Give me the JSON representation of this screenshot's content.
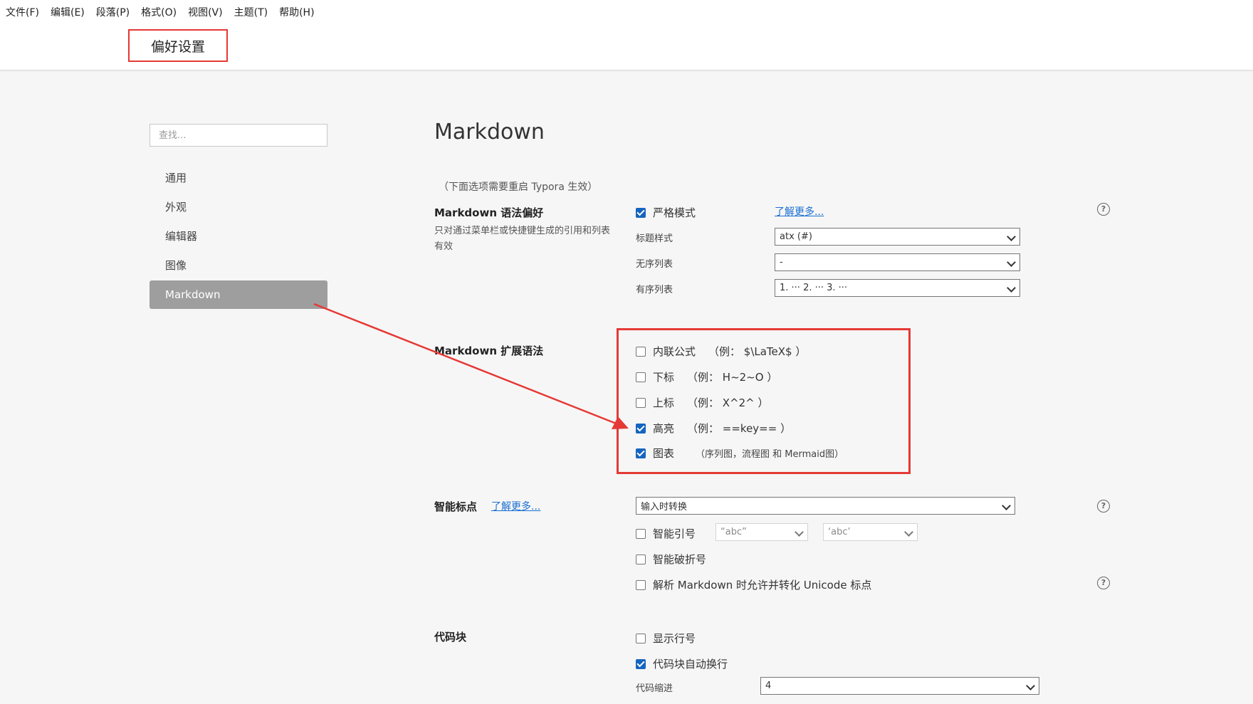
{
  "menubar": [
    "文件(F)",
    "编辑(E)",
    "段落(P)",
    "格式(O)",
    "视图(V)",
    "主题(T)",
    "帮助(H)"
  ],
  "window_title": "偏好设置",
  "sidebar": {
    "search_placeholder": "查找...",
    "items": [
      {
        "label": "通用",
        "active": false
      },
      {
        "label": "外观",
        "active": false
      },
      {
        "label": "编辑器",
        "active": false
      },
      {
        "label": "图像",
        "active": false
      },
      {
        "label": "Markdown",
        "active": true
      }
    ]
  },
  "main": {
    "title": "Markdown",
    "restart_note": "（下面选项需要重启 Typora 生效）",
    "syntax_pref": {
      "title": "Markdown 语法偏好",
      "desc": "只对通过菜单栏或快捷键生成的引用和列表有效",
      "strict_mode": {
        "label": "严格模式",
        "checked": true
      },
      "learn_more": "了解更多...",
      "heading_style": {
        "label": "标题样式",
        "value": "atx (#)"
      },
      "unordered_list": {
        "label": "无序列表",
        "value": "-"
      },
      "ordered_list": {
        "label": "有序列表",
        "value": "1. ··· 2. ··· 3. ···"
      }
    },
    "ext_syntax": {
      "title": "Markdown 扩展语法",
      "options": [
        {
          "label": "内联公式",
          "example": "（例： $\\LaTeX$ ）",
          "checked": false
        },
        {
          "label": "下标",
          "example": "（例： H~2~O ）",
          "checked": false
        },
        {
          "label": "上标",
          "example": "（例： X^2^ ）",
          "checked": false
        },
        {
          "label": "高亮",
          "example": "（例： ==key== ）",
          "checked": true
        },
        {
          "label": "图表",
          "example": "（序列图，流程图 和 Mermaid图）",
          "checked": true
        }
      ]
    },
    "smart_punct": {
      "title": "智能标点",
      "learn_more": "了解更多...",
      "mode": "输入时转换",
      "smart_quotes": {
        "label": "智能引号",
        "checked": false,
        "double": "“abc”",
        "single": "‘abc’"
      },
      "smart_dash": {
        "label": "智能破折号",
        "checked": false
      },
      "unicode_punct": {
        "label": "解析 Markdown 时允许并转化 Unicode 标点",
        "checked": false
      }
    },
    "code_block": {
      "title": "代码块",
      "line_numbers": {
        "label": "显示行号",
        "checked": false
      },
      "auto_wrap": {
        "label": "代码块自动换行",
        "checked": true
      },
      "indent": {
        "label": "代码缩进",
        "value": "4"
      }
    }
  },
  "colors": {
    "accent": "#1565c0",
    "highlight_red": "#e53935",
    "active_nav": "#9e9e9e",
    "link": "#1a6fd1"
  }
}
